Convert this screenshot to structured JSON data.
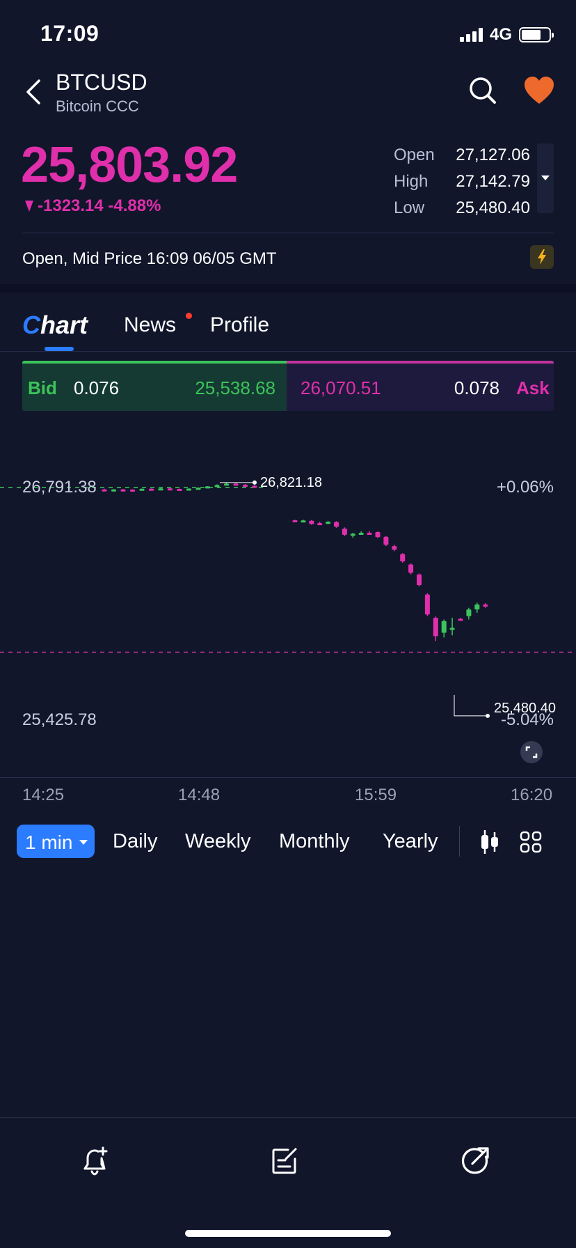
{
  "status_bar": {
    "time": "17:09",
    "network": "4G"
  },
  "header": {
    "symbol": "BTCUSD",
    "name": "Bitcoin CCC"
  },
  "quote": {
    "price": "25,803.92",
    "change": "-1323.14 -4.88%",
    "open_label": "Open",
    "open": "27,127.06",
    "high_label": "High",
    "high": "27,142.79",
    "low_label": "Low",
    "low": "25,480.40",
    "status": "Open, Mid Price 16:09 06/05 GMT"
  },
  "tabs": {
    "chart_first": "C",
    "chart_rest": "hart",
    "news": "News",
    "profile": "Profile"
  },
  "bid_ask": {
    "bid_label": "Bid",
    "bid_spread": "0.076",
    "bid_price": "25,538.68",
    "ask_price": "26,070.51",
    "ask_spread": "0.078",
    "ask_label": "Ask"
  },
  "chart": {
    "y_top": "26,791.38",
    "y_bottom": "25,425.78",
    "pct_top": "+0.06%",
    "pct_bottom": "-5.04%",
    "high_marker": "26,821.18",
    "low_marker": "25,480.40",
    "x_ticks": [
      "14:25",
      "14:48",
      "15:59",
      "16:20"
    ]
  },
  "chart_data": {
    "type": "candlestick",
    "x_ticks": [
      "14:25",
      "14:48",
      "15:59",
      "16:20"
    ],
    "y_labels": [
      "26,791.38",
      "25,425.78"
    ],
    "markers": {
      "high": 26821.18,
      "low": 25480.4
    },
    "current_price": 25803.92,
    "ylim": [
      25425.78,
      26791.38
    ],
    "candles": [
      {
        "o": 26780,
        "h": 26784,
        "l": 26776,
        "c": 26778,
        "dir": "down"
      },
      {
        "o": 26779,
        "h": 26782,
        "l": 26777,
        "c": 26780,
        "dir": "up"
      },
      {
        "o": 26780,
        "h": 26783,
        "l": 26778,
        "c": 26779,
        "dir": "down"
      },
      {
        "o": 26779,
        "h": 26781,
        "l": 26777,
        "c": 26778,
        "dir": "down"
      },
      {
        "o": 26778,
        "h": 26785,
        "l": 26777,
        "c": 26784,
        "dir": "up"
      },
      {
        "o": 26784,
        "h": 26786,
        "l": 26780,
        "c": 26782,
        "dir": "down"
      },
      {
        "o": 26782,
        "h": 26788,
        "l": 26781,
        "c": 26786,
        "dir": "up"
      },
      {
        "o": 26786,
        "h": 26787,
        "l": 26782,
        "c": 26783,
        "dir": "down"
      },
      {
        "o": 26783,
        "h": 26785,
        "l": 26781,
        "c": 26782,
        "dir": "down"
      },
      {
        "o": 26782,
        "h": 26786,
        "l": 26781,
        "c": 26785,
        "dir": "up"
      },
      {
        "o": 26785,
        "h": 26792,
        "l": 26784,
        "c": 26790,
        "dir": "up"
      },
      {
        "o": 26790,
        "h": 26800,
        "l": 26788,
        "c": 26798,
        "dir": "up"
      },
      {
        "o": 26798,
        "h": 26810,
        "l": 26796,
        "c": 26806,
        "dir": "up"
      },
      {
        "o": 26806,
        "h": 26821,
        "l": 26803,
        "c": 26815,
        "dir": "up"
      },
      {
        "o": 26815,
        "h": 26818,
        "l": 26805,
        "c": 26808,
        "dir": "down"
      },
      {
        "o": 26808,
        "h": 26812,
        "l": 26800,
        "c": 26802,
        "dir": "down"
      },
      {
        "o": 26802,
        "h": 26806,
        "l": 26792,
        "c": 26795,
        "dir": "down"
      },
      {
        "o": 26595,
        "h": 26598,
        "l": 26588,
        "c": 26590,
        "dir": "down"
      },
      {
        "o": 26588,
        "h": 26598,
        "l": 26584,
        "c": 26594,
        "dir": "up"
      },
      {
        "o": 26592,
        "h": 26596,
        "l": 26568,
        "c": 26572,
        "dir": "down"
      },
      {
        "o": 26578,
        "h": 26586,
        "l": 26570,
        "c": 26574,
        "dir": "down"
      },
      {
        "o": 26576,
        "h": 26590,
        "l": 26572,
        "c": 26586,
        "dir": "up"
      },
      {
        "o": 26584,
        "h": 26590,
        "l": 26550,
        "c": 26556,
        "dir": "down"
      },
      {
        "o": 26545,
        "h": 26552,
        "l": 26500,
        "c": 26508,
        "dir": "down"
      },
      {
        "o": 26508,
        "h": 26520,
        "l": 26490,
        "c": 26514,
        "dir": "up"
      },
      {
        "o": 26514,
        "h": 26528,
        "l": 26508,
        "c": 26520,
        "dir": "up"
      },
      {
        "o": 26520,
        "h": 26530,
        "l": 26512,
        "c": 26516,
        "dir": "down"
      },
      {
        "o": 26524,
        "h": 26528,
        "l": 26488,
        "c": 26494,
        "dir": "down"
      },
      {
        "o": 26496,
        "h": 26500,
        "l": 26440,
        "c": 26448,
        "dir": "down"
      },
      {
        "o": 26440,
        "h": 26448,
        "l": 26410,
        "c": 26418,
        "dir": "down"
      },
      {
        "o": 26392,
        "h": 26398,
        "l": 26340,
        "c": 26348,
        "dir": "down"
      },
      {
        "o": 26330,
        "h": 26336,
        "l": 26270,
        "c": 26280,
        "dir": "down"
      },
      {
        "o": 26270,
        "h": 26276,
        "l": 26198,
        "c": 26206,
        "dir": "down"
      },
      {
        "o": 26150,
        "h": 26158,
        "l": 26020,
        "c": 26030,
        "dir": "down"
      },
      {
        "o": 26010,
        "h": 26018,
        "l": 25870,
        "c": 25900,
        "dir": "down"
      },
      {
        "o": 25920,
        "h": 26000,
        "l": 25892,
        "c": 25990,
        "dir": "up"
      },
      {
        "o": 25950,
        "h": 26010,
        "l": 25905,
        "c": 25950,
        "dir": "up"
      },
      {
        "o": 26000,
        "h": 26010,
        "l": 25998,
        "c": 26004,
        "dir": "down"
      },
      {
        "o": 26020,
        "h": 26070,
        "l": 26000,
        "c": 26060,
        "dir": "up"
      },
      {
        "o": 26060,
        "h": 26100,
        "l": 26040,
        "c": 26090,
        "dir": "up"
      },
      {
        "o": 26090,
        "h": 26098,
        "l": 26070,
        "c": 26080,
        "dir": "down"
      }
    ]
  },
  "periods": {
    "selected": "1 min",
    "daily": "Daily",
    "weekly": "Weekly",
    "monthly": "Monthly",
    "yearly": "Yearly"
  },
  "colors": {
    "up": "#3cc45a",
    "down": "#e02fab",
    "accent": "#2b7cff",
    "heart": "#ee6a2c",
    "background": "#11162b"
  },
  "icons": {
    "back": "chevron-left-icon",
    "search": "search-icon",
    "favorite": "heart-icon",
    "flash": "lightning-icon",
    "expand": "expand-icon",
    "chart_type": "candlestick-icon",
    "layout": "grid-icon",
    "alert": "bell-plus-icon",
    "note": "note-edit-icon",
    "share": "share-arrow-icon"
  }
}
